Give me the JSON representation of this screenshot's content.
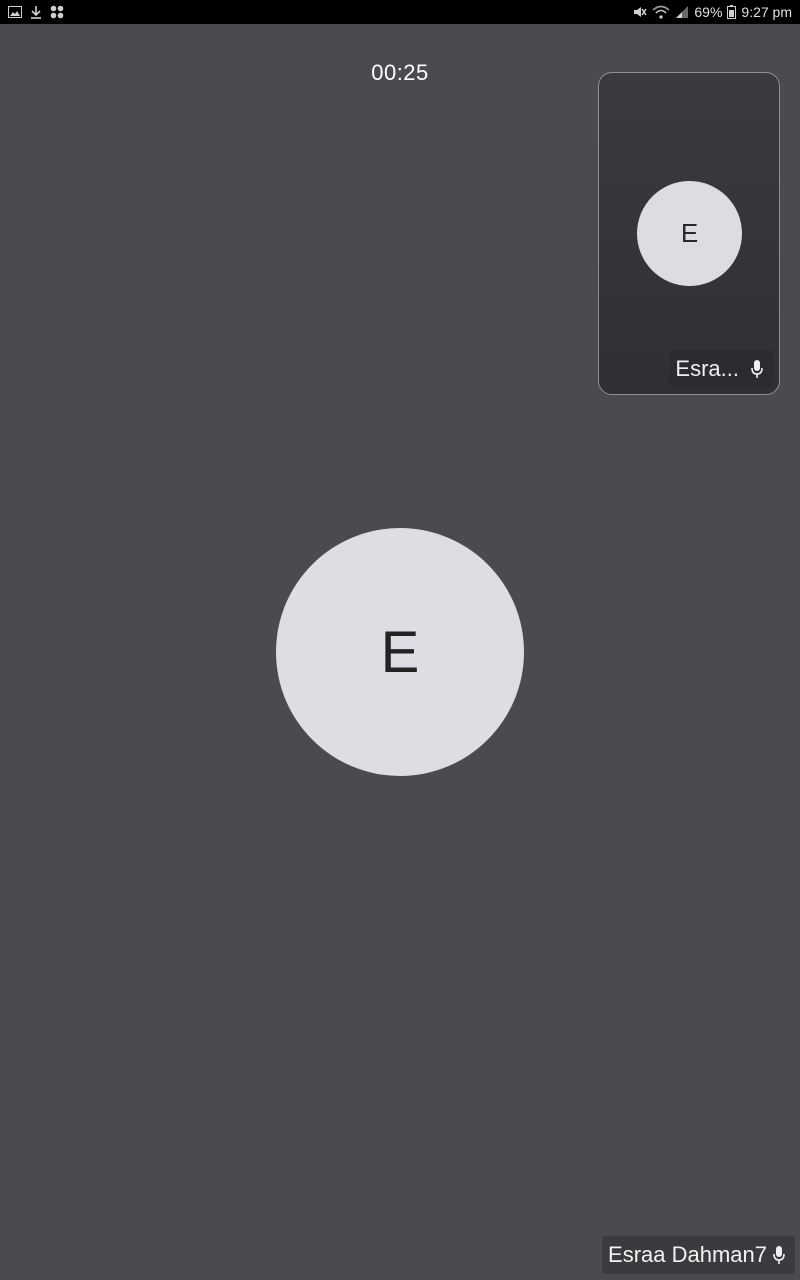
{
  "status_bar": {
    "battery_percent": "69%",
    "time": "9:27 pm",
    "icons": [
      "gallery-icon",
      "download-icon",
      "apps-icon",
      "mute-icon",
      "wifi-icon",
      "signal-icon",
      "battery-icon"
    ]
  },
  "call": {
    "timer": "00:25"
  },
  "self_view": {
    "initial": "E",
    "name": "Esra..."
  },
  "remote": {
    "initial": "E",
    "name": "Esraa Dahman7"
  },
  "colors": {
    "background": "#4a4b4e",
    "avatar": "#dddee3",
    "tile": "#333438"
  }
}
